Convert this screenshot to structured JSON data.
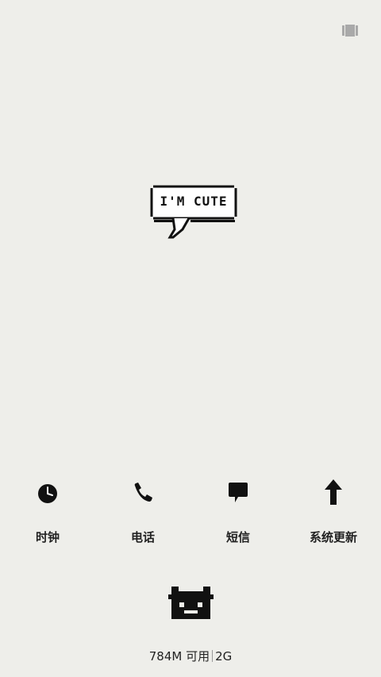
{
  "top_bar": {
    "icon": "multitask-icon"
  },
  "widget": {
    "bubble_text": "I'M CUTE"
  },
  "dock": {
    "apps": [
      {
        "label": "时钟",
        "icon": "clock-icon"
      },
      {
        "label": "电话",
        "icon": "phone-icon"
      },
      {
        "label": "短信",
        "icon": "message-icon"
      },
      {
        "label": "系统更新",
        "icon": "update-arrow-icon"
      }
    ]
  },
  "status": {
    "memory": "784M 可用",
    "network": "2G"
  },
  "colors": {
    "background": "#eeeeea",
    "icon": "#111111",
    "text": "#222222"
  }
}
